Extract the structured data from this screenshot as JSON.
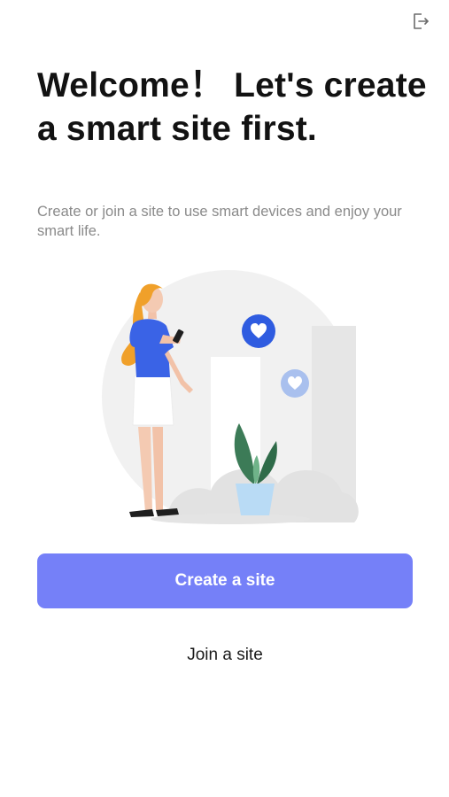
{
  "header": {
    "logout_icon": "logout-icon"
  },
  "welcome": {
    "title": "Welcome！ Let's create a smart site first.",
    "subtitle": "Create or join a site to use smart devices and enjoy your smart life."
  },
  "actions": {
    "create_label": "Create a site",
    "join_label": "Join a site"
  },
  "colors": {
    "accent": "#7580f8",
    "heart_primary": "#2f5ce0",
    "heart_secondary": "#a9c0ee",
    "shirt": "#3a63e6",
    "hair": "#f0a02a",
    "plant": "#3c7b57",
    "pot": "#b9dbf5"
  },
  "illustration": {
    "icons": [
      "heart-badge-icon",
      "heart-badge-small-icon",
      "plant-icon"
    ]
  }
}
